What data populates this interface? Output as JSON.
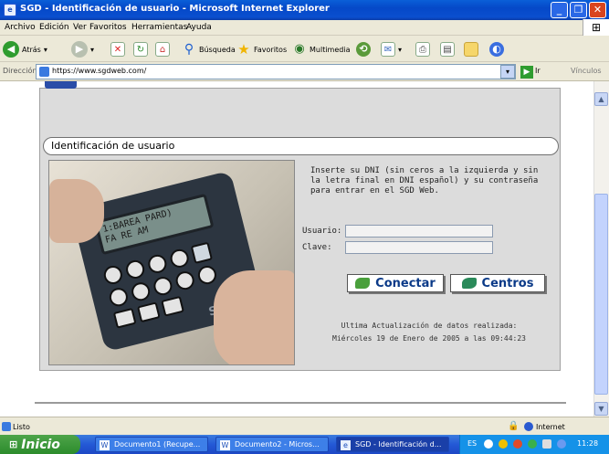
{
  "window": {
    "title": "SGD - Identificación de usuario - Microsoft Internet Explorer",
    "minimize_icon": "minimize-icon",
    "maximize_icon": "maximize-icon",
    "close_icon": "close-icon"
  },
  "menubar": [
    "Archivo",
    "Edición",
    "Ver",
    "Favoritos",
    "Herramientas",
    "Ayuda"
  ],
  "toolbar": {
    "back": "Atrás",
    "search": "Búsqueda",
    "favorites": "Favoritos",
    "multimedia": "Multimedia"
  },
  "address": {
    "label": "Dirección",
    "url": "https://www.sgdweb.com/",
    "go": "Ir",
    "links": "Vínculos"
  },
  "page": {
    "section_title": "Identificación de usuario",
    "instructions": "Inserte su DNI (sin ceros a la izquierda y sin la letra final en DNI español) y su contraseña para entrar en el SGD Web.",
    "usuario_label": "Usuario:",
    "clave_label": "Clave:",
    "usuario_value": "",
    "clave_value": "",
    "conectar_label": "Conectar",
    "centros_label": "Centros",
    "update_line1": "Ultima Actualización de datos realizada:",
    "update_line2": "Miércoles 19 de Enero de 2005 a las 09:44:23",
    "device_screen_line1": "1:BAREA PARD)",
    "device_screen_line2": "FA RE AM",
    "device_brand": "SGD"
  },
  "status": {
    "text": "Listo",
    "zone": "Internet"
  },
  "taskbar": {
    "start": "Inicio",
    "tasks": [
      "Documento1 (Recupe...",
      "Documento2 - Micros...",
      "SGD - Identificación d..."
    ],
    "lang": "ES",
    "time": "11:28"
  },
  "colors": {
    "title_bar": "#0a5fd8",
    "panel": "#dcdcdc",
    "button_text": "#0b3a88",
    "start_green": "#3c9a3a"
  }
}
